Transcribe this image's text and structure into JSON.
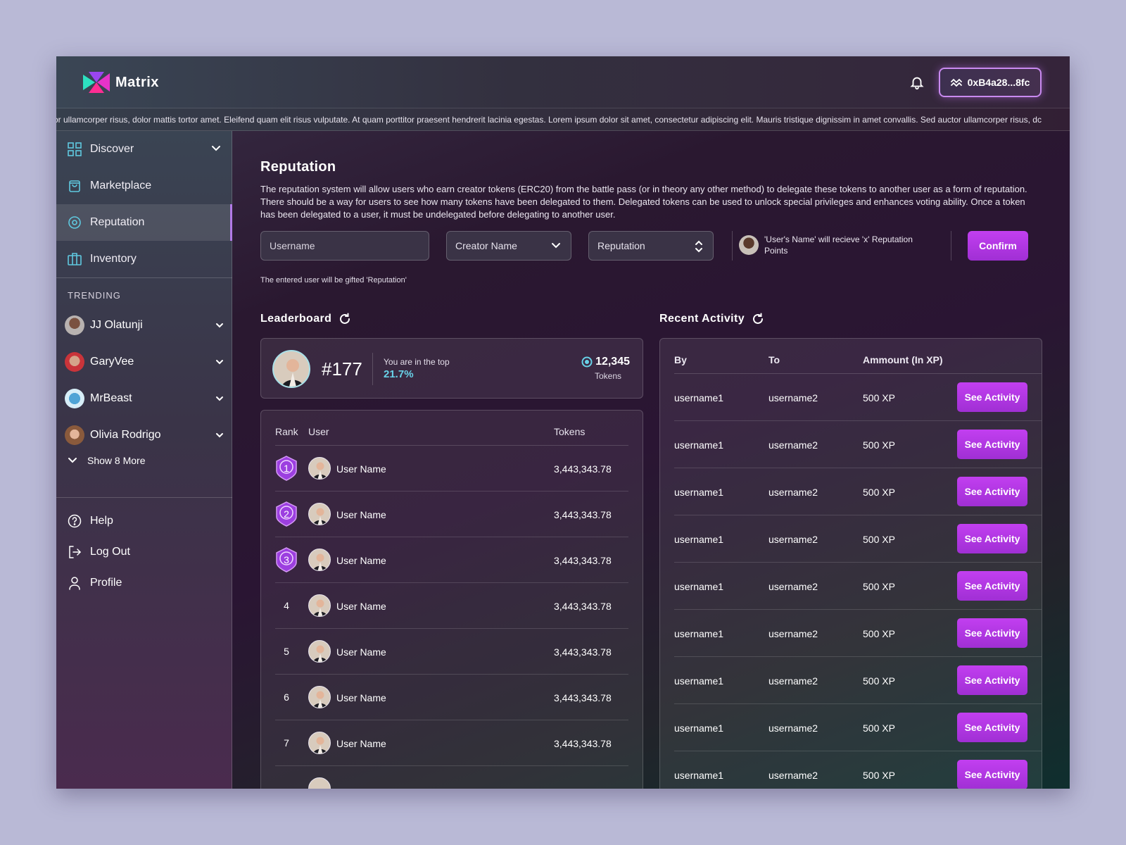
{
  "header": {
    "app_name": "Matrix",
    "wallet_address": "0xB4a28...8fc",
    "ticker_text": "or ullamcorper risus, dolor mattis tortor amet. Eleifend quam elit risus vulputate. At quam porttitor praesent hendrerit lacinia egestas. Lorem ipsum dolor sit amet, consectetur adipiscing elit. Mauris tristique dignissim in amet convallis. Sed auctor ullamcorper risus, dc"
  },
  "sidebar": {
    "nav": [
      {
        "label": "Discover",
        "icon": "grid-icon"
      },
      {
        "label": "Marketplace",
        "icon": "bag-icon"
      },
      {
        "label": "Reputation",
        "icon": "target-icon"
      },
      {
        "label": "Inventory",
        "icon": "briefcase-icon"
      }
    ],
    "trending_title": "TRENDING",
    "trending": [
      {
        "name": "JJ Olatunji"
      },
      {
        "name": "GaryVee"
      },
      {
        "name": "MrBeast"
      },
      {
        "name": "Olivia Rodrigo"
      }
    ],
    "show_more": "Show 8 More",
    "footer": [
      {
        "label": "Help",
        "icon": "help-icon"
      },
      {
        "label": "Log Out",
        "icon": "logout-icon"
      },
      {
        "label": "Profile",
        "icon": "user-icon"
      }
    ]
  },
  "reputation": {
    "title": "Reputation",
    "description": "The reputation system will allow users who earn creator tokens (ERC20) from the battle pass (or in theory any other method) to delegate these tokens to another user as a form of reputation. There should be a way for users to see how many tokens have been delegated to them. Delegated tokens can be used to unlock special privileges and enhances voting ability. Once a token has been delegated to a user, it must be undelegated before delegating to another user.",
    "username_placeholder": "Username",
    "creator_select": "Creator Name",
    "reputation_select": "Reputation",
    "notice": "'User's Name' will recieve 'x' Reputation Points",
    "confirm_label": "Confirm",
    "gift_note": "The entered user will be gifted 'Reputation'"
  },
  "leaderboard": {
    "title": "Leaderboard",
    "my_rank": "#177",
    "top_label": "You are in the top",
    "top_value": "21.7%",
    "my_tokens": "12,345",
    "tokens_label": "Tokens",
    "columns": [
      "Rank",
      "User",
      "Tokens"
    ],
    "rows": [
      {
        "rank": "1",
        "user": "User Name",
        "tokens": "3,443,343.78"
      },
      {
        "rank": "2",
        "user": "User Name",
        "tokens": "3,443,343.78"
      },
      {
        "rank": "3",
        "user": "User Name",
        "tokens": "3,443,343.78"
      },
      {
        "rank": "4",
        "user": "User Name",
        "tokens": "3,443,343.78"
      },
      {
        "rank": "5",
        "user": "User Name",
        "tokens": "3,443,343.78"
      },
      {
        "rank": "6",
        "user": "User Name",
        "tokens": "3,443,343.78"
      },
      {
        "rank": "7",
        "user": "User Name",
        "tokens": "3,443,343.78"
      }
    ]
  },
  "activity": {
    "title": "Recent Activity",
    "columns": [
      "By",
      "To",
      "Ammount (In XP)"
    ],
    "button_label": "See Activity",
    "rows": [
      {
        "by": "username1",
        "to": "username2",
        "amount": "500 XP"
      },
      {
        "by": "username1",
        "to": "username2",
        "amount": "500 XP"
      },
      {
        "by": "username1",
        "to": "username2",
        "amount": "500 XP"
      },
      {
        "by": "username1",
        "to": "username2",
        "amount": "500 XP"
      },
      {
        "by": "username1",
        "to": "username2",
        "amount": "500 XP"
      },
      {
        "by": "username1",
        "to": "username2",
        "amount": "500 XP"
      },
      {
        "by": "username1",
        "to": "username2",
        "amount": "500 XP"
      },
      {
        "by": "username1",
        "to": "username2",
        "amount": "500 XP"
      },
      {
        "by": "username1",
        "to": "username2",
        "amount": "500 XP"
      }
    ]
  },
  "colors": {
    "accent": "#b43ae6",
    "cyan": "#68d2e8"
  }
}
